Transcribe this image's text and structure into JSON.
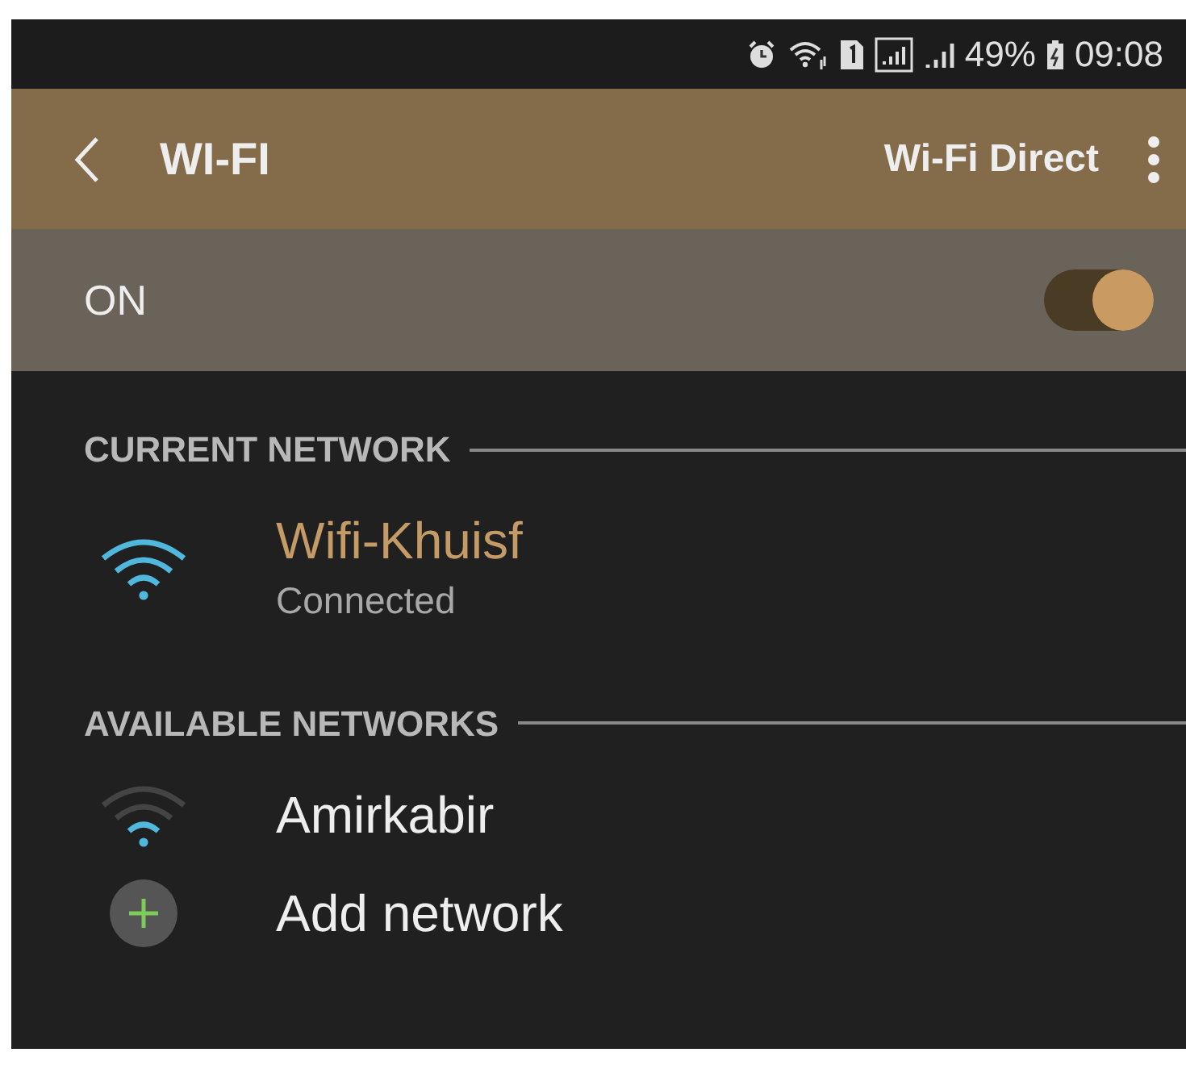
{
  "status_bar": {
    "battery": "49%",
    "time": "09:08"
  },
  "header": {
    "title": "WI-FI",
    "action": "Wi-Fi Direct"
  },
  "master_switch": {
    "label": "ON",
    "on": true
  },
  "sections": [
    {
      "title": "CURRENT NETWORK",
      "items": [
        {
          "kind": "network",
          "name": "Wifi-Khuisf",
          "status": "Connected",
          "connected": true
        }
      ]
    },
    {
      "title": "AVAILABLE NETWORKS",
      "items": [
        {
          "kind": "network",
          "name": "Amirkabir",
          "connected": false
        },
        {
          "kind": "add",
          "name": "Add network"
        }
      ]
    }
  ]
}
